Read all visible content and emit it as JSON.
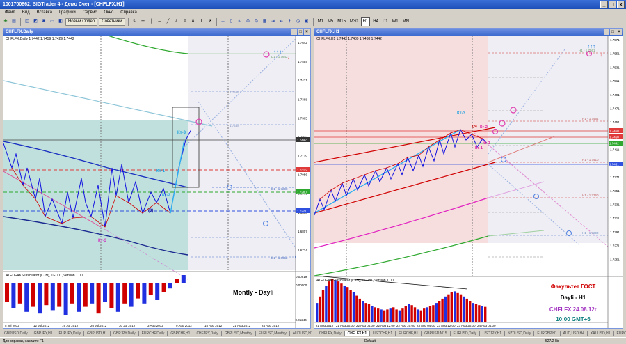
{
  "window": {
    "title": "1001700862: SIGTrader 4 - Демо Счет - [CHFLFX,H1]",
    "controls": [
      "_",
      "□",
      "×"
    ]
  },
  "menu": [
    "Файл",
    "Вид",
    "Вставка",
    "Графики",
    "Сервис",
    "Окно",
    "Справка"
  ],
  "toolbar": {
    "new_order": "Новый Ордер",
    "advisors": "Советники",
    "timeframes": [
      "M1",
      "M5",
      "M15",
      "M30",
      "H1",
      "H4",
      "D1",
      "W1",
      "MN"
    ],
    "active_tf": "H1"
  },
  "left_chart": {
    "title": "CHFLFX,Daily",
    "info": "CHFLFX,Daily  1.7442 1.7459 1.7429 1.7442",
    "indicator_info": "ATEI.GAKS.Oscillator (CJH), TF: D1, version 1.00",
    "prices": [
      "1.7642",
      "1.7554",
      "1.7471",
      "1.7388",
      "1.7305",
      "1.7222",
      "1.7139",
      "1.7056",
      "1.6973",
      "1.6890",
      "1.6807",
      "1.6724"
    ],
    "price_tags": {
      "top": "1.7442",
      "mid": "1.7315",
      "green": "1.7280",
      "blue": "1.7221"
    },
    "level_labels": {
      "d1_top": "D1 - 1.7642",
      "d1_mid": "D1 - 1.7208",
      "d1_bot": "D1 - 1.6952",
      "r1": "1.7556",
      "r2": "1.7488"
    },
    "osc_scale": [
      "0.00919",
      "0.00000",
      "-0.01244"
    ],
    "dates": [
      "5 Jul 2012",
      "12 Jul 2012",
      "19 Jul 2012",
      "26 Jul 2012",
      "30 Jul 2012",
      "3 Aug 2012",
      "9 Aug 2012",
      "15 Aug 2012",
      "21 Aug 2012",
      "24 Aug 2012"
    ],
    "wave_labels": {
      "k3_top": "Кт-3",
      "k1": "Кт-1",
      "k2": "Кт-2",
      "zero": "(0)",
      "k3_bot": "Кт-3"
    },
    "caption": "Montly - Dayli"
  },
  "right_chart": {
    "title": "CHFLFX,H1",
    "info": "CHFLFX,H1  1.7442 1.7489 1.7438 1.7442",
    "indicator_info": "ATEI.GAKS.Oscillator (CJH), TF: H1, version 1.00",
    "prices": [
      "1.7571",
      "1.7551",
      "1.7531",
      "1.7511",
      "1.7491",
      "1.7471",
      "1.7451",
      "1.7431",
      "1.7411",
      "1.7391",
      "1.7371",
      "1.7351",
      "1.7331",
      "1.7311",
      "1.7291",
      "1.7271",
      "1.7251"
    ],
    "price_tags": {
      "red1": "1.7460",
      "red2": "1.7450",
      "green": "1.7442",
      "blue": "1.7431"
    },
    "level_labels": {
      "h1_top": "H1 - 1.7561",
      "h1_a": "H1 - 1.7464",
      "h1_b": "H1 - 1.7410",
      "h1_c": "H1 - 1.7360",
      "h1_d": "H1 - 1.7290"
    },
    "dates": [
      "21 Aug 2012",
      "21 Aug 20:00",
      "22 Aug 04:00",
      "22 Aug 12:00",
      "22 Aug 20:00",
      "23 Aug 04:00",
      "23 Aug 12:00",
      "23 Aug 20:00",
      "24 Aug 04:00"
    ],
    "wave_labels": {
      "k3": "Кт-3",
      "k3r": "(3)",
      "k2": "Кт-2",
      "k1": "Кт-1",
      "k3b": "Кт-3"
    },
    "promo": {
      "line1": "Факультет ГОСТ",
      "line2": "Dayli - H1",
      "line3": "CHFLFX 24.08.12г",
      "line4": "10:00 GMT+6"
    }
  },
  "tabs": [
    "GBPUSD,Daily",
    "GBPJPY,H1",
    "EURJPY,Daily",
    "GBPUSD,H1",
    "GBPJPY,Daily",
    "EURCHF,Daily",
    "GBPCHF,H1",
    "CHFJPY,Daily",
    "GBPUSD,Monthly",
    "EURUSD,Monthly",
    "AUDUSD,H1",
    "CHFLFX,Daily",
    "CHFLFX,H1",
    "USDCHF,H1",
    "EURCHF,H1",
    "GBPUSD,M15",
    "EURUSD,Daily",
    "USDJPY,H1",
    "NZDUSD,Daily",
    "EURGBP,H1",
    "AUD,USD,H4",
    "XAUUSD,H1",
    "EURCAD,H1"
  ],
  "active_tab": "CHFLFX,H1",
  "status": {
    "help": "Для справки, нажмите F1",
    "profile": "Default",
    "traffic": "527/2 kb"
  },
  "colors": {
    "accent": "#1d4fb8",
    "up": "#d00000",
    "down": "#1010e0",
    "teal_zone": "#bfe0dc",
    "pink_zone": "#f7dede"
  }
}
